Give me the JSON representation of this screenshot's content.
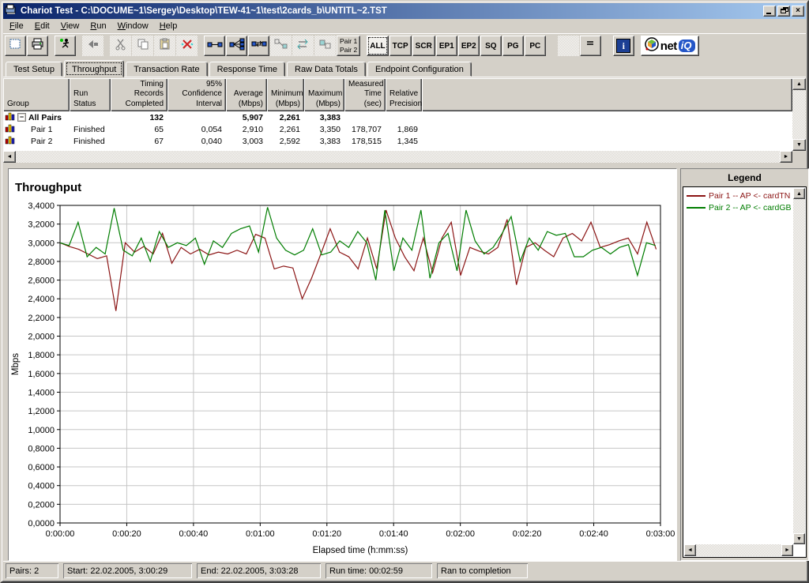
{
  "window": {
    "title": "Chariot Test - C:\\DOCUME~1\\Sergey\\Desktop\\TEW-41~1\\test\\2cards_b\\UNTITL~2.TST"
  },
  "icons": {
    "scroll_up": "▲",
    "scroll_down": "▼",
    "scroll_left": "◄",
    "scroll_right": "►",
    "close": "×",
    "collapse": "−",
    "info": "i"
  },
  "menu": {
    "items": [
      [
        "F",
        "ile"
      ],
      [
        "E",
        "dit"
      ],
      [
        "V",
        "iew"
      ],
      [
        "R",
        "un"
      ],
      [
        "W",
        "indow"
      ],
      [
        "H",
        "elp"
      ]
    ]
  },
  "toolbar": {
    "pair_button_line1": "Pair 1",
    "pair_button_line2": "Pair 2",
    "filters": [
      "ALL",
      "TCP",
      "SCR",
      "EP1",
      "EP2",
      "SQ",
      "PG",
      "PC"
    ],
    "brand_net": "net",
    "brand_iq": "iQ"
  },
  "tabs": {
    "active": "Throughput",
    "items": [
      "Test Setup",
      "Throughput",
      "Transaction Rate",
      "Response Time",
      "Raw Data Totals",
      "Endpoint Configuration"
    ]
  },
  "results_table": {
    "columns": [
      {
        "lines": [
          "",
          "Group"
        ],
        "align": "left"
      },
      {
        "lines": [
          "",
          "Run Status"
        ],
        "align": "left"
      },
      {
        "lines": [
          "Timing Records",
          "Completed"
        ],
        "align": "right"
      },
      {
        "lines": [
          "95% Confidence",
          "Interval"
        ],
        "align": "right"
      },
      {
        "lines": [
          "Average",
          "(Mbps)"
        ],
        "align": "right"
      },
      {
        "lines": [
          "Minimum",
          "(Mbps)"
        ],
        "align": "right"
      },
      {
        "lines": [
          "Maximum",
          "(Mbps)"
        ],
        "align": "right"
      },
      {
        "lines": [
          "Measured",
          "Time (sec)"
        ],
        "align": "right"
      },
      {
        "lines": [
          "Relative",
          "Precision"
        ],
        "align": "right"
      }
    ],
    "rows": [
      {
        "group": "All Pairs",
        "run_status": "",
        "timing_records": "132",
        "confidence_interval": "",
        "average": "5,907",
        "minimum": "2,261",
        "maximum": "3,383",
        "measured_time": "",
        "relative_precision": ""
      },
      {
        "group": "Pair 1",
        "run_status": "Finished",
        "timing_records": "65",
        "confidence_interval": "0,054",
        "average": "2,910",
        "minimum": "2,261",
        "maximum": "3,350",
        "measured_time": "178,707",
        "relative_precision": "1,869"
      },
      {
        "group": "Pair 2",
        "run_status": "Finished",
        "timing_records": "67",
        "confidence_interval": "0,040",
        "average": "3,003",
        "minimum": "2,592",
        "maximum": "3,383",
        "measured_time": "178,515",
        "relative_precision": "1,345"
      }
    ]
  },
  "legend": {
    "title": "Legend",
    "items": [
      {
        "label": "Pair 1 -- AP <- cardTN",
        "color": "#8b1414"
      },
      {
        "label": "Pair 2 -- AP <- cardGB",
        "color": "#007d00"
      }
    ]
  },
  "chart_data": {
    "type": "line",
    "title": "Throughput",
    "xlabel": "Elapsed time (h:mm:ss)",
    "ylabel": "Mbps",
    "ylim": [
      0,
      3.4
    ],
    "y_tick_step": 0.2,
    "xlim_seconds": [
      0,
      180
    ],
    "x_tick_step_seconds": 20,
    "x_tick_labels": [
      "0:00:00",
      "0:00:20",
      "0:00:40",
      "0:01:00",
      "0:01:20",
      "0:01:40",
      "0:02:00",
      "0:02:20",
      "0:02:40",
      "0:03:00"
    ],
    "grid": true,
    "legend_position": "right-panel",
    "series": [
      {
        "name": "Pair 1 -- AP <- cardTN",
        "color": "#8b1414",
        "duration_seconds": 178.707,
        "values": [
          3.0,
          2.96,
          2.93,
          2.88,
          2.83,
          2.86,
          2.27,
          3.0,
          2.9,
          2.96,
          2.88,
          3.1,
          2.78,
          2.95,
          2.88,
          2.93,
          2.87,
          2.9,
          2.88,
          2.92,
          2.88,
          3.09,
          3.05,
          2.72,
          2.75,
          2.73,
          2.4,
          2.62,
          2.88,
          3.15,
          2.9,
          2.85,
          2.72,
          3.05,
          2.72,
          3.35,
          3.05,
          2.85,
          2.7,
          3.05,
          2.68,
          3.05,
          3.22,
          2.65,
          2.95,
          2.91,
          2.88,
          2.95,
          3.25,
          2.55,
          2.95,
          3.0,
          2.92,
          2.85,
          3.05,
          3.1,
          3.02,
          3.22,
          2.95,
          2.98,
          3.02,
          3.05,
          2.88,
          3.22,
          2.93
        ]
      },
      {
        "name": "Pair 2 -- AP <- cardGB",
        "color": "#007d00",
        "duration_seconds": 178.515,
        "values": [
          3.0,
          2.97,
          3.22,
          2.85,
          2.95,
          2.88,
          3.37,
          2.92,
          2.86,
          3.05,
          2.8,
          3.12,
          2.95,
          3.0,
          2.97,
          3.05,
          2.77,
          3.02,
          2.95,
          3.1,
          3.15,
          3.18,
          2.9,
          3.38,
          3.05,
          2.92,
          2.87,
          2.92,
          3.15,
          2.87,
          2.9,
          3.02,
          2.95,
          3.12,
          3.0,
          2.6,
          3.35,
          2.7,
          3.05,
          2.92,
          3.35,
          2.62,
          3.0,
          3.1,
          2.7,
          3.35,
          3.02,
          2.88,
          2.95,
          3.1,
          3.28,
          2.8,
          3.05,
          2.92,
          3.12,
          3.08,
          3.1,
          2.85,
          2.85,
          2.92,
          2.95,
          2.88,
          2.95,
          2.98,
          2.65,
          3.0,
          2.97
        ]
      }
    ]
  },
  "status_bar": {
    "pairs": "Pairs: 2",
    "start": "Start: 22.02.2005, 3:00:29",
    "end": "End: 22.02.2005, 3:03:28",
    "run_time": "Run time: 00:02:59",
    "completion": "Ran to completion"
  }
}
